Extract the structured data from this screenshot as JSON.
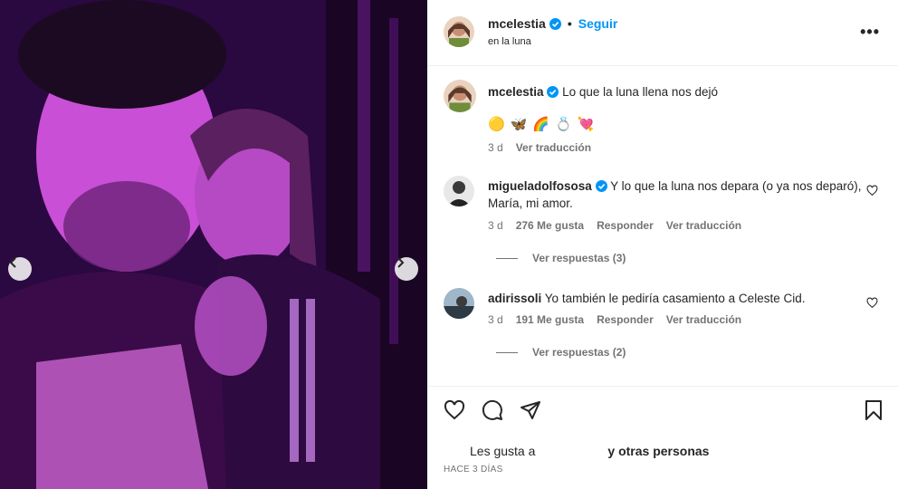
{
  "post": {
    "username": "mcelestia",
    "follow_label": "Seguir",
    "location": "en la luna",
    "more_label": "•••"
  },
  "caption": {
    "username": "mcelestia",
    "text": "Lo que la luna llena nos dejó",
    "emojis": "🟡🦋🌈💍💘",
    "time": "3 d",
    "translate": "Ver traducción"
  },
  "comments": [
    {
      "username": "migueladolfososa",
      "text": "Y lo que la luna nos depara (o ya nos deparó), María, mi amor.",
      "time": "3 d",
      "likes": "276 Me gusta",
      "reply": "Responder",
      "translate": "Ver traducción",
      "view_replies": "Ver respuestas (3)"
    },
    {
      "username": "adirissoli",
      "text": "Yo también le pediría casamiento a Celeste Cid.",
      "time": "3 d",
      "likes": "191 Me gusta",
      "reply": "Responder",
      "translate": "Ver traducción",
      "view_replies": "Ver respuestas (2)"
    }
  ],
  "likes_summary": {
    "prefix": "Les gusta a",
    "suffix": "y otras personas"
  },
  "timestamp": "HACE 3 DÍAS",
  "colors": {
    "accent": "#0095f6",
    "verified": "#0095f6",
    "secondary_text": "#737373",
    "photo_tint": "#8b2fb0"
  },
  "icons": [
    "chevron-left-icon",
    "chevron-right-icon",
    "verified-icon",
    "more-icon",
    "heart-icon",
    "comment-icon",
    "share-icon",
    "bookmark-icon"
  ]
}
